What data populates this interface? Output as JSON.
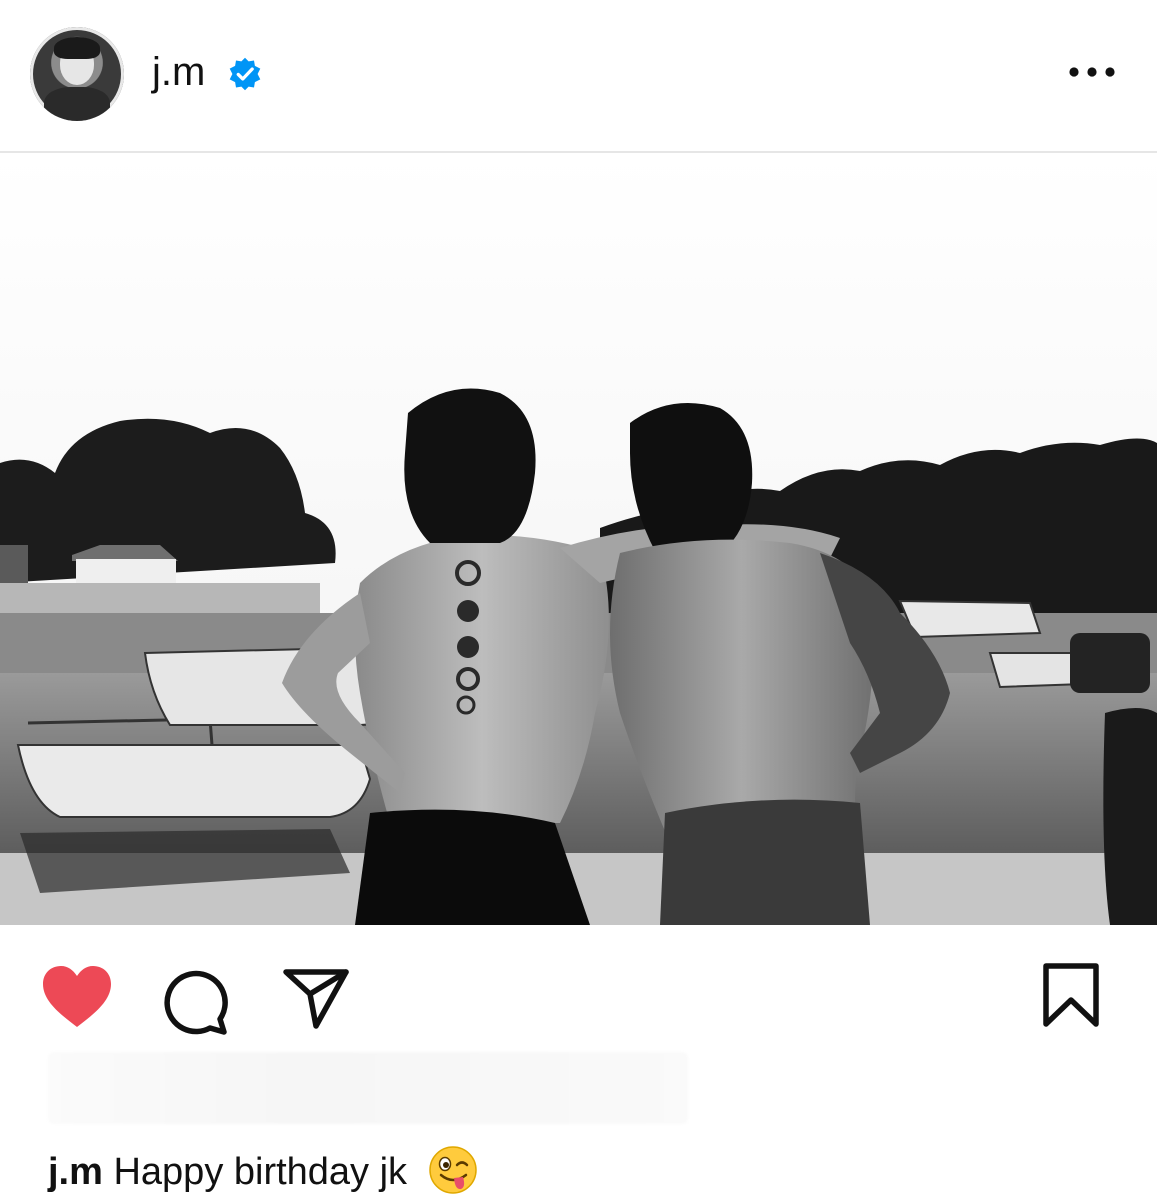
{
  "post": {
    "username": "j.m",
    "verified": true,
    "more_icon": "ellipsis-horizontal-icon",
    "liked": true,
    "caption": {
      "username": "j.m",
      "text": "Happy birthday jk",
      "emoji": "😜"
    }
  },
  "icons": {
    "like": "heart-filled-icon",
    "comment": "speech-bubble-icon",
    "share": "paper-plane-icon",
    "save": "bookmark-icon"
  },
  "colors": {
    "like_red": "#ED4956",
    "verified_blue": "#0095F6",
    "text": "#111111"
  }
}
